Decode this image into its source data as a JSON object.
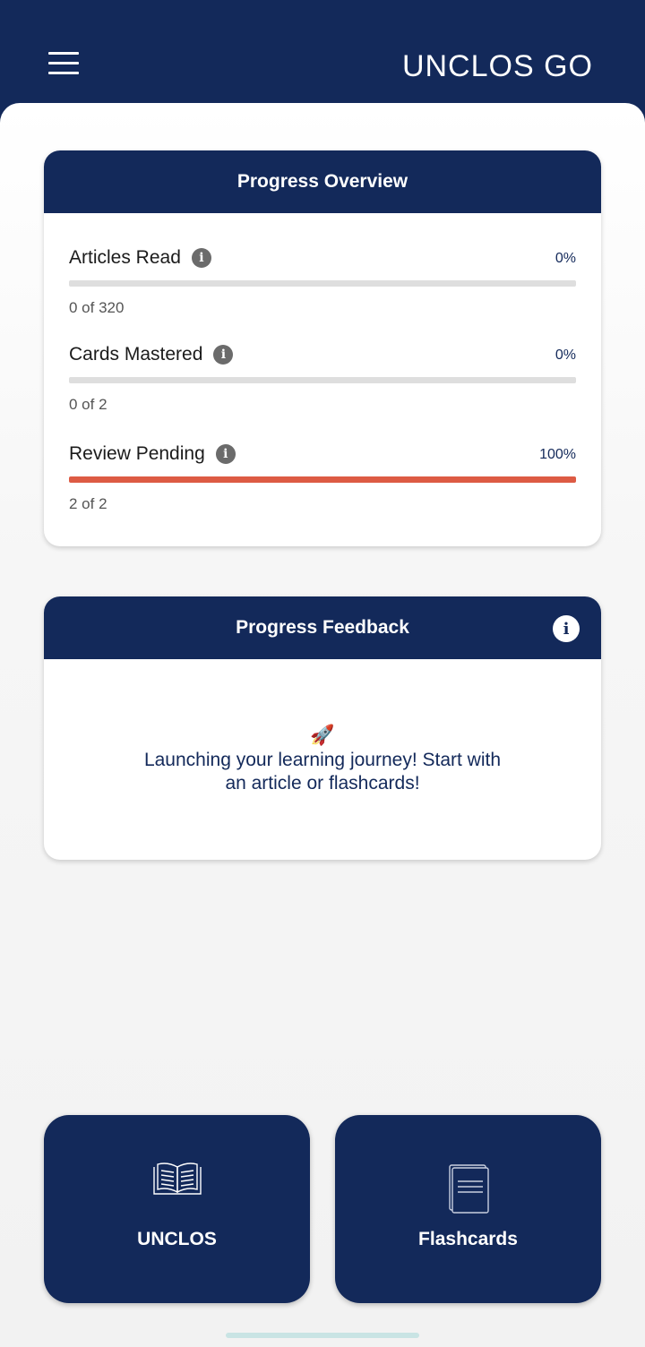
{
  "app_bar": {
    "title": "UNCLOS GO",
    "menu_icon": "hamburger-menu-icon"
  },
  "progress_overview": {
    "title": "Progress Overview",
    "metrics": [
      {
        "label": "Articles Read",
        "percent_label": "0%",
        "count_label": "0 of 320",
        "progress": 0,
        "fill_color": "#dd5b44"
      },
      {
        "label": "Cards Mastered",
        "percent_label": "0%",
        "count_label": "0 of 2",
        "progress": 0,
        "fill_color": "#dd5b44"
      },
      {
        "label": "Review Pending",
        "percent_label": "100%",
        "count_label": "2 of 2",
        "progress": 1,
        "fill_color": "#dd5b44"
      }
    ],
    "info_icon": "info-icon"
  },
  "progress_feedback": {
    "title": "Progress Feedback",
    "emoji": "🚀",
    "message": "Launching your learning journey! Start with an article or flashcards!"
  },
  "nav": {
    "unclos": {
      "label": "UNCLOS",
      "icon": "open-book-icon"
    },
    "flashcards": {
      "label": "Flashcards",
      "icon": "card-stack-icon"
    }
  },
  "colors": {
    "primary": "#13295a",
    "accent": "#dd5b44",
    "track": "#dedede",
    "background": "#f4f4f4"
  }
}
